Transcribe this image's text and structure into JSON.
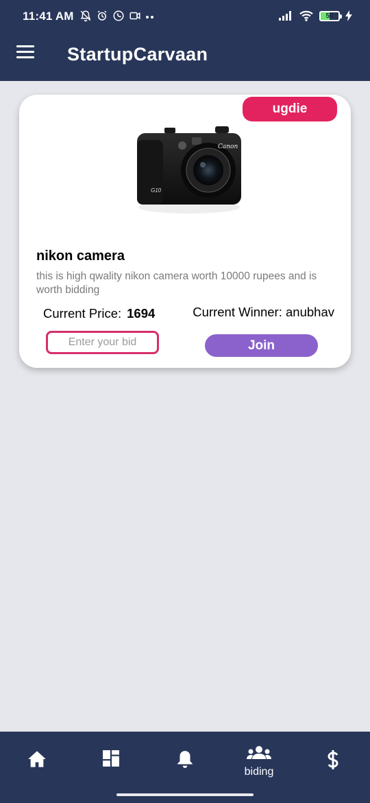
{
  "status_bar": {
    "time": "11:41 AM",
    "battery_level": "50",
    "icons": [
      "notifications-off-icon",
      "alarm-icon",
      "whatsapp-icon",
      "video-icon",
      "more-dots-icon",
      "signal-icon",
      "wifi-icon",
      "battery-icon",
      "charging-icon"
    ]
  },
  "app_bar": {
    "title": "StartupCarvaan",
    "menu_icon": "hamburger-menu-icon"
  },
  "auction_card": {
    "seller": "ugdie",
    "product_name": "nikon camera",
    "description": "this is high qwality nikon camera worth 10000 rupees and is worth bidding",
    "price_label": "Current Price:",
    "price_value": "1694",
    "winner_label": "Current Winner:",
    "winner_name": "anubhav",
    "bid_placeholder": "Enter your bid",
    "bid_value": "",
    "join_label": "Join",
    "image_labels": {
      "brand": "Canon",
      "model": "G10"
    }
  },
  "bottom_nav": {
    "items": [
      {
        "icon": "home-icon",
        "label": ""
      },
      {
        "icon": "dashboard-icon",
        "label": ""
      },
      {
        "icon": "bell-icon",
        "label": ""
      },
      {
        "icon": "group-icon",
        "label": "biding"
      },
      {
        "icon": "dollar-icon",
        "label": ""
      }
    ]
  },
  "colors": {
    "primary": "#283659",
    "background": "#e6e7ec",
    "badge": "#e3235f",
    "bid_border": "#d62e6a",
    "join_button": "#8b62cc"
  }
}
